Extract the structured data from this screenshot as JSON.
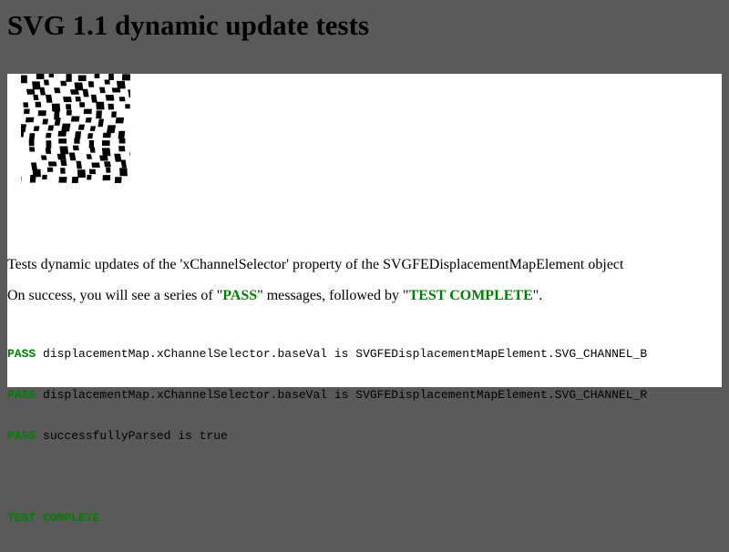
{
  "page": {
    "title": "SVG 1.1 dynamic update tests"
  },
  "description": {
    "line1": "Tests dynamic updates of the 'xChannelSelector' property of the SVGFEDisplacementMapElement object",
    "line2_prefix": "On success, you will see a series of \"",
    "line2_pass": "PASS",
    "line2_middle": "\" messages, followed by \"",
    "line2_complete": "TEST COMPLETE",
    "line2_suffix": "\"."
  },
  "console": {
    "lines": [
      {
        "tag": "PASS",
        "text": " displacementMap.xChannelSelector.baseVal is SVGFEDisplacementMapElement.SVG_CHANNEL_B"
      },
      {
        "tag": "PASS",
        "text": " displacementMap.xChannelSelector.baseVal is SVGFEDisplacementMapElement.SVG_CHANNEL_R"
      },
      {
        "tag": "PASS",
        "text": " successfullyParsed is true"
      }
    ],
    "complete": "TEST COMPLETE"
  },
  "colors": {
    "background": "#5a5a5a",
    "pass": "#008000"
  }
}
